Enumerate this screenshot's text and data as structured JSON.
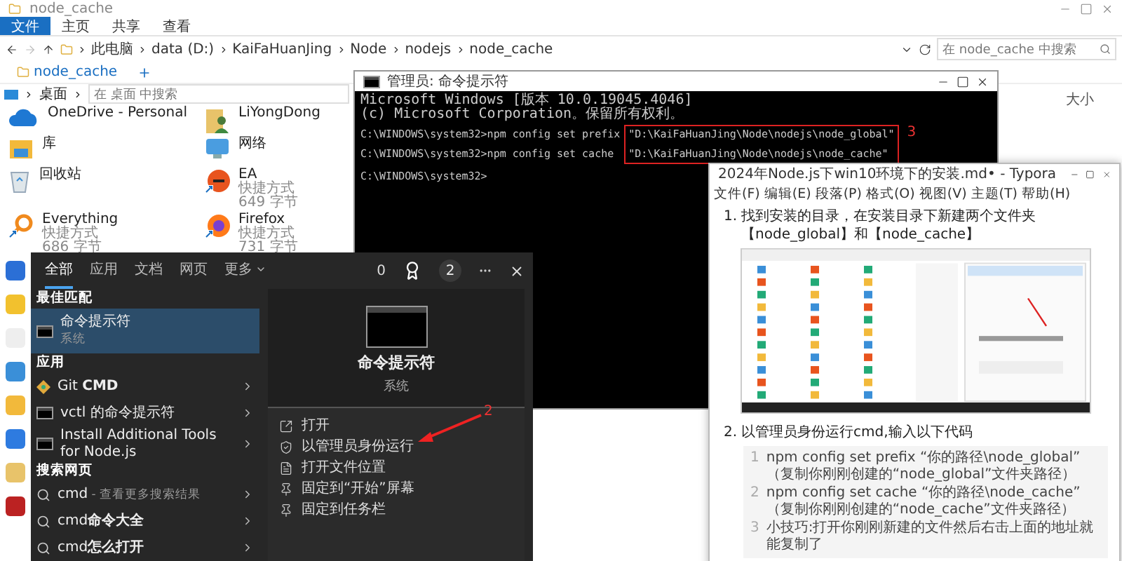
{
  "explorer": {
    "title": "node_cache",
    "ribbon_tabs": [
      {
        "label": "文件",
        "selected": true
      },
      {
        "label": "主页",
        "selected": false
      },
      {
        "label": "共享",
        "selected": false
      },
      {
        "label": "查看",
        "selected": false
      }
    ],
    "breadcrumb": [
      "此电脑",
      "data (D:)",
      "KaiFaHuanJing",
      "Node",
      "nodejs",
      "node_cache"
    ],
    "search_placeholder": "在 node_cache 中搜索",
    "tab": "node_cache",
    "pane_location": "桌面",
    "pane_search_placeholder": "在 桌面 中搜索",
    "column_header": "大小",
    "items": [
      {
        "kind": "cloud",
        "name": "OneDrive - Personal"
      },
      {
        "kind": "user",
        "name": "LiYongDong"
      },
      {
        "kind": "library",
        "name": "库"
      },
      {
        "kind": "network",
        "name": "网络"
      },
      {
        "kind": "recycle",
        "name": "回收站"
      },
      {
        "kind": "ea",
        "name": "EA",
        "type": "快捷方式",
        "size": "649 字节"
      },
      {
        "kind": "everything",
        "name": "Everything",
        "type": "快捷方式",
        "size": "686 字节"
      },
      {
        "kind": "firefox",
        "name": "Firefox",
        "type": "快捷方式",
        "size": "731 字节"
      }
    ]
  },
  "cmd": {
    "title": "管理员: 命令提示符",
    "header_lines": [
      "Microsoft Windows [版本 10.0.19045.4046]",
      "(c) Microsoft Corporation。保留所有权利。"
    ],
    "commands": [
      {
        "prompt": "C:\\WINDOWS\\system32>npm config set prefix",
        "value": "\"D:\\KaiFaHuanJing\\Node\\nodejs\\node_global\""
      },
      {
        "prompt": "C:\\WINDOWS\\system32>npm config set cache",
        "value": "\"D:\\KaiFaHuanJing\\Node\\nodejs\\node_cache\""
      }
    ],
    "final_prompt": "C:\\WINDOWS\\system32>",
    "annotation": "3"
  },
  "typora": {
    "title": "2024年Node.js下win10环境下的安装.md• - Typora",
    "menu": [
      "文件(F)",
      "编辑(E)",
      "段落(P)",
      "格式(O)",
      "视图(V)",
      "主题(T)",
      "帮助(H)"
    ],
    "steps": [
      {
        "number": "1.",
        "text": "找到安装的目录，在安装目录下新建两个文件夹【node_global】和【node_cache】",
        "screenshot": true
      },
      {
        "number": "2.",
        "text": "以管理员身份运行cmd,输入以下代码",
        "screenshot": false
      }
    ],
    "code_lines": [
      {
        "number": "1",
        "text": "npm config set prefix “你的路径\\node_global” （复制你刚刚创建的“node_global”文件夹路径）"
      },
      {
        "number": "2",
        "text": "npm config set cache “你的路径\\node_cache” （复制你刚刚创建的“node_cache”文件夹路径）"
      },
      {
        "number": "3",
        "text": "小技巧:打开你刚刚新建的文件然后右击上面的地址就能复制了"
      }
    ]
  },
  "search": {
    "tabs": [
      {
        "label": "全部",
        "selected": true
      },
      {
        "label": "应用",
        "selected": false
      },
      {
        "label": "文档",
        "selected": false
      },
      {
        "label": "网页",
        "selected": false
      },
      {
        "label": "更多",
        "selected": false
      }
    ],
    "points": "0",
    "badge_count": "2",
    "sections": [
      {
        "title": "最佳匹配",
        "items": [
          {
            "kind": "best",
            "title": "命令提示符",
            "subtitle": "系统",
            "selected": true
          }
        ]
      },
      {
        "title": "应用",
        "items": [
          {
            "kind": "app",
            "title": "Git **CMD**",
            "selected": false
          },
          {
            "kind": "app",
            "title": "vctl 的命令提示符",
            "selected": false
          },
          {
            "kind": "app",
            "title": "Install Additional Tools for Node.js",
            "selected": false
          }
        ]
      },
      {
        "title": "搜索网页",
        "items": [
          {
            "kind": "web",
            "title": "cmd",
            "hint": "- 查看更多搜索结果",
            "selected": false
          },
          {
            "kind": "web",
            "title": "cmd**命令大全**",
            "selected": false
          },
          {
            "kind": "web",
            "title": "cmd**怎么打开**",
            "selected": false
          }
        ]
      }
    ],
    "detail": {
      "title": "命令提示符",
      "subtitle": "系统",
      "actions": [
        "打开",
        "以管理员身份运行",
        "打开文件位置",
        "固定到“开始”屏幕",
        "固定到任务栏"
      ],
      "annotation": "2"
    }
  }
}
